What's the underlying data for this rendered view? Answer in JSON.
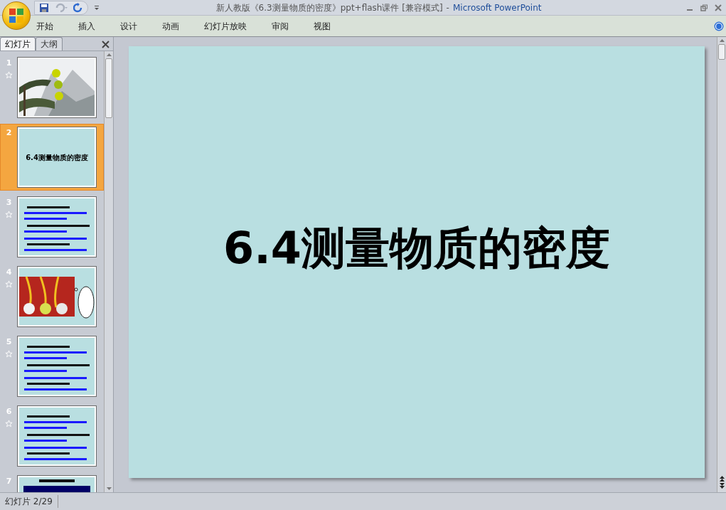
{
  "window": {
    "document_title": "新人教版《6.3测量物质的密度》ppt+flash课件 [兼容模式]",
    "separator": "-",
    "app_name": "Microsoft PowerPoint"
  },
  "ribbon_tabs": [
    "开始",
    "插入",
    "设计",
    "动画",
    "幻灯片放映",
    "审阅",
    "视图"
  ],
  "panel_tabs": [
    {
      "label": "幻灯片",
      "selected": true
    },
    {
      "label": "大纲",
      "selected": false
    }
  ],
  "slides": [
    {
      "number": "1",
      "kind": "landscape",
      "animated": true,
      "selected": false
    },
    {
      "number": "2",
      "kind": "title",
      "title": "6.4测量物质的密度",
      "animated": false,
      "selected": true
    },
    {
      "number": "3",
      "kind": "text",
      "animated": true,
      "selected": false
    },
    {
      "number": "4",
      "animated": true,
      "selected": false
    },
    {
      "number": "5",
      "kind": "text",
      "animated": true,
      "selected": false
    },
    {
      "number": "6",
      "kind": "text",
      "animated": true,
      "selected": false
    },
    {
      "number": "7",
      "kind": "banner",
      "animated": false,
      "selected": false
    }
  ],
  "current_slide": {
    "title": "6.4测量物质的密度"
  },
  "status_bar": {
    "slide_indicator": "幻灯片 2/29"
  }
}
